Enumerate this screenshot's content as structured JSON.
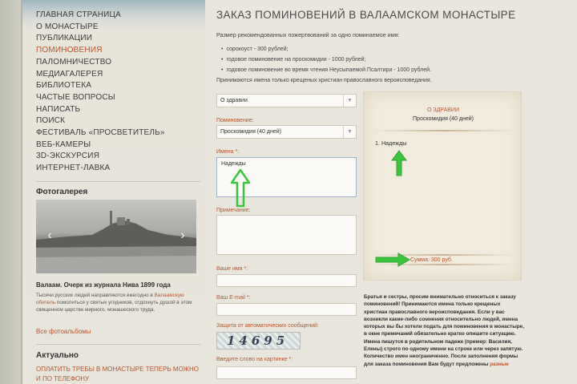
{
  "nav": {
    "items": [
      {
        "label": "ГЛАВНАЯ СТРАНИЦА",
        "active": false
      },
      {
        "label": "О МОНАСТЫРЕ",
        "active": false
      },
      {
        "label": "ПУБЛИКАЦИИ",
        "active": false
      },
      {
        "label": "ПОМИНОВЕНИЯ",
        "active": true
      },
      {
        "label": "ПАЛОМНИЧЕСТВО",
        "active": false
      },
      {
        "label": "МЕДИАГАЛЕРЕЯ",
        "active": false
      },
      {
        "label": "БИБЛИОТЕКА",
        "active": false
      },
      {
        "label": "ЧАСТЫЕ ВОПРОСЫ",
        "active": false
      },
      {
        "label": "НАПИСАТЬ",
        "active": false
      },
      {
        "label": "ПОИСК",
        "active": false
      },
      {
        "label": "ФЕСТИВАЛЬ «ПРОСВЕТИТЕЛЬ»",
        "active": false
      },
      {
        "label": "ВЕБ-КАМЕРЫ",
        "active": false
      },
      {
        "label": "3D-ЭКСКУРСИЯ",
        "active": false
      },
      {
        "label": "ИНТЕРНЕТ-ЛАВКА",
        "active": false
      }
    ]
  },
  "gallery": {
    "heading": "Фотогалерея",
    "caption": "Валаам. Очерк из журнала Нива 1899 года",
    "text_1": "Тысячи русских людей направляются ежегодно в ",
    "text_link": "Валаамскую обитель",
    "text_2": " помолиться у святых угодников, отдохнуть душой в этом священном царстве мирного, монашеского труда.",
    "all_albums": "Все фотоальбомы"
  },
  "actual": {
    "heading": "Актуально",
    "link": "ОПЛАТИТЬ ТРЕБЫ В МОНАСТЫРЕ ТЕПЕРЬ МОЖНО И ПО ТЕЛЕФОНУ"
  },
  "page": {
    "title": "ЗАКАЗ ПОМИНОВЕНИЙ В ВАЛААМСКОМ МОНАСТЫРЕ",
    "intro": "Размер рекомендованных пожертвований за одно поминаемое имя:",
    "bullets": [
      "сорокоуст - 300 рублей;",
      "годовое поминовение на проскомидии - 1000 рублей;",
      "годовое поминовение во время чтения Неусыпаемой Псалтири - 1000 рублей."
    ],
    "note": "Принимаются имена только крещеных христиан православного вероисповедания."
  },
  "form": {
    "type_value": "О здравии",
    "commemoration_label": "Поминовение:",
    "commemoration_value": "Проскомидия (40 дней)",
    "names_label": "Имена *:",
    "names_value": "Надежды",
    "remark_label": "Примечание:",
    "your_name_label": "Ваше имя *:",
    "email_label": "Ваш E-mail *:",
    "captcha_label": "Защита от автоматических сообщений:",
    "captcha_text": "14695",
    "captcha_input_label": "Введите слово на картинке *:"
  },
  "preview": {
    "heading": "О ЗДРАВИИ",
    "subheading": "Проскомидия (40 дней)",
    "names": [
      "1. Надежды"
    ],
    "sum": "Сумма: 300 руб."
  },
  "info": {
    "text": "Братья и сестры, просим внимательно относиться к заказу поминовений! Принимаются имена только крещеных христиан православного вероисповедания. Если у вас возникли какие-либо сомнения относительно людей, имена которых вы бы хотели подать для поминовения в монастыре, в окне примечаний обязательно кратко опишите ситуацию. Имена пишутся в родительном падеже (пример: Василия, Елены) строго по одному имени на строке или через запятую. Количество имен неограниченно. После заполнения формы для заказа поминовения Вам будут предложены ",
    "link": "разные"
  },
  "colors": {
    "accent": "#b8562c",
    "annotation_arrow": "#3cc43c"
  },
  "icons": {
    "chevron": "chevron-down-icon",
    "prev": "chevron-left-icon",
    "next": "chevron-right-icon",
    "annotation": "green-arrow-icon"
  }
}
